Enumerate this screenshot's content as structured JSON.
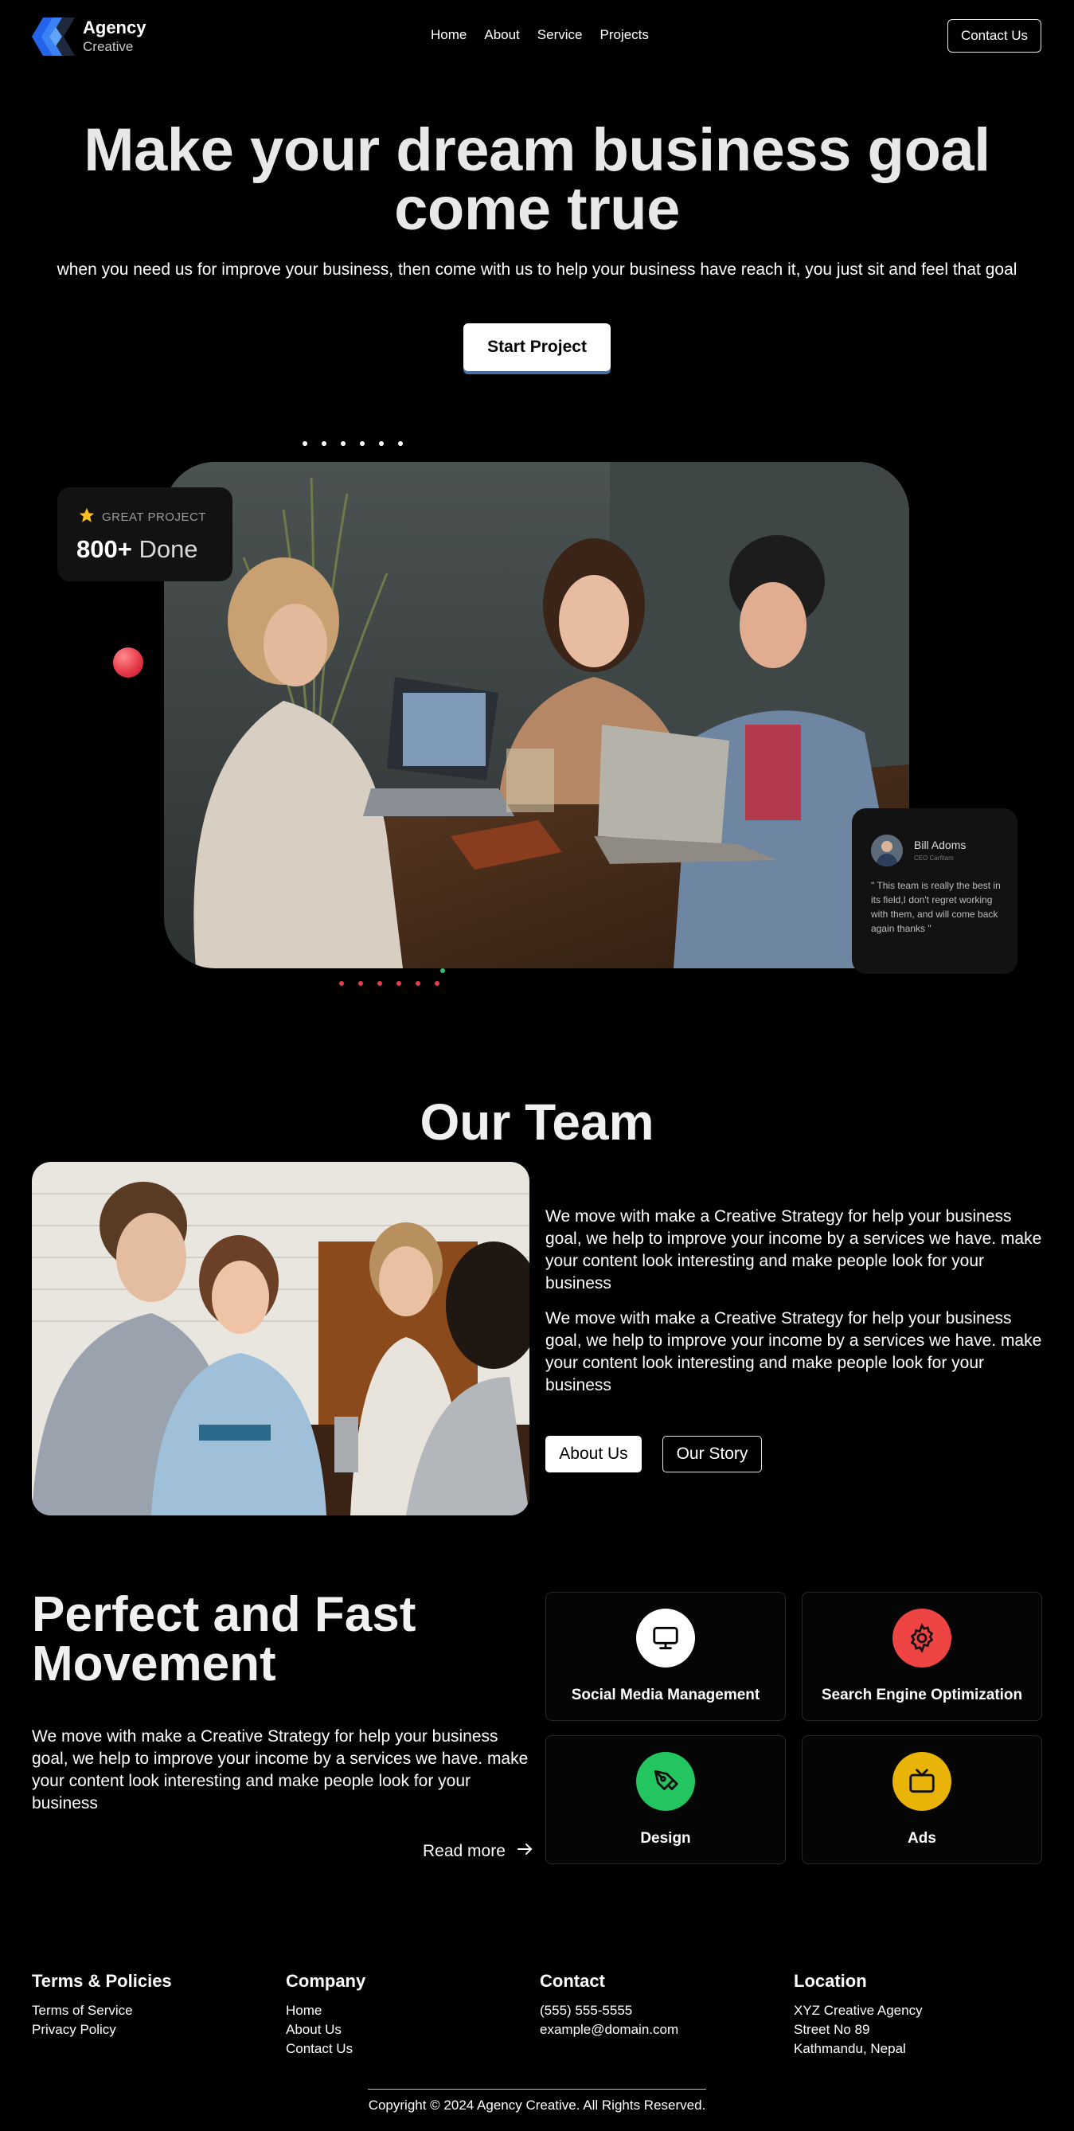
{
  "nav": {
    "brand_name": "Agency",
    "brand_sub": "Creative",
    "links": [
      "Home",
      "About",
      "Service",
      "Projects"
    ],
    "contact_label": "Contact Us"
  },
  "hero": {
    "title": "Make your dream business goal come true",
    "subtitle": "when you need us for improve your business, then come with us to help your business have reach it, you just sit and feel that goal",
    "cta": "Start Project"
  },
  "stat_card": {
    "tag": "GREAT PROJECT",
    "value": "800+",
    "value_suffix": " Done"
  },
  "review": {
    "name": "Bill Adoms",
    "role": "CEO Carfitam",
    "text": "\" This team is really the best in its field,I don't regret working with them, and will come back again thanks \""
  },
  "team": {
    "title": "Our Team",
    "paragraph_1": "We move with make a Creative Strategy for help your business goal, we help to improve your income by a services we have. make your content look interesting and make people look for your business",
    "paragraph_2": "We move with make a Creative Strategy for help your business goal, we help to improve your income by a services we have. make your content look interesting and make people look for your business",
    "about_label": "About Us",
    "story_label": "Our Story"
  },
  "services_section": {
    "title": "Perfect and Fast Movement",
    "paragraph": "We move with make a Creative Strategy for help your business goal, we help to improve your income by a services we have. make your content look interesting and make people look for your business",
    "read_more": "Read more",
    "items": [
      {
        "label": "Social Media Management",
        "icon": "monitor-icon",
        "color": "#ffffff"
      },
      {
        "label": "Search Engine Optimization",
        "icon": "gear-icon",
        "color": "#ef4444"
      },
      {
        "label": "Design",
        "icon": "pen-tool-icon",
        "color": "#22c55e"
      },
      {
        "label": "Ads",
        "icon": "tv-icon",
        "color": "#eab308"
      }
    ]
  },
  "footer": {
    "terms": {
      "title": "Terms & Policies",
      "items": [
        "Terms of Service",
        "Privacy Policy"
      ]
    },
    "company": {
      "title": "Company",
      "items": [
        "Home",
        "About Us",
        "Contact Us"
      ]
    },
    "contact": {
      "title": "Contact",
      "items": [
        "(555) 555-5555",
        "example@domain.com"
      ]
    },
    "location": {
      "title": "Location",
      "items": [
        "XYZ Creative Agency",
        "Street No 89",
        "Kathmandu, Nepal"
      ]
    },
    "copyright": "Copyright © 2024 Agency Creative. All Rights Reserved."
  },
  "colors": {
    "background": "#000000",
    "accent_red": "#e73a4a",
    "accent_green": "#22c55e",
    "accent_yellow": "#eab308",
    "logo_blue": "#3b82f6"
  }
}
